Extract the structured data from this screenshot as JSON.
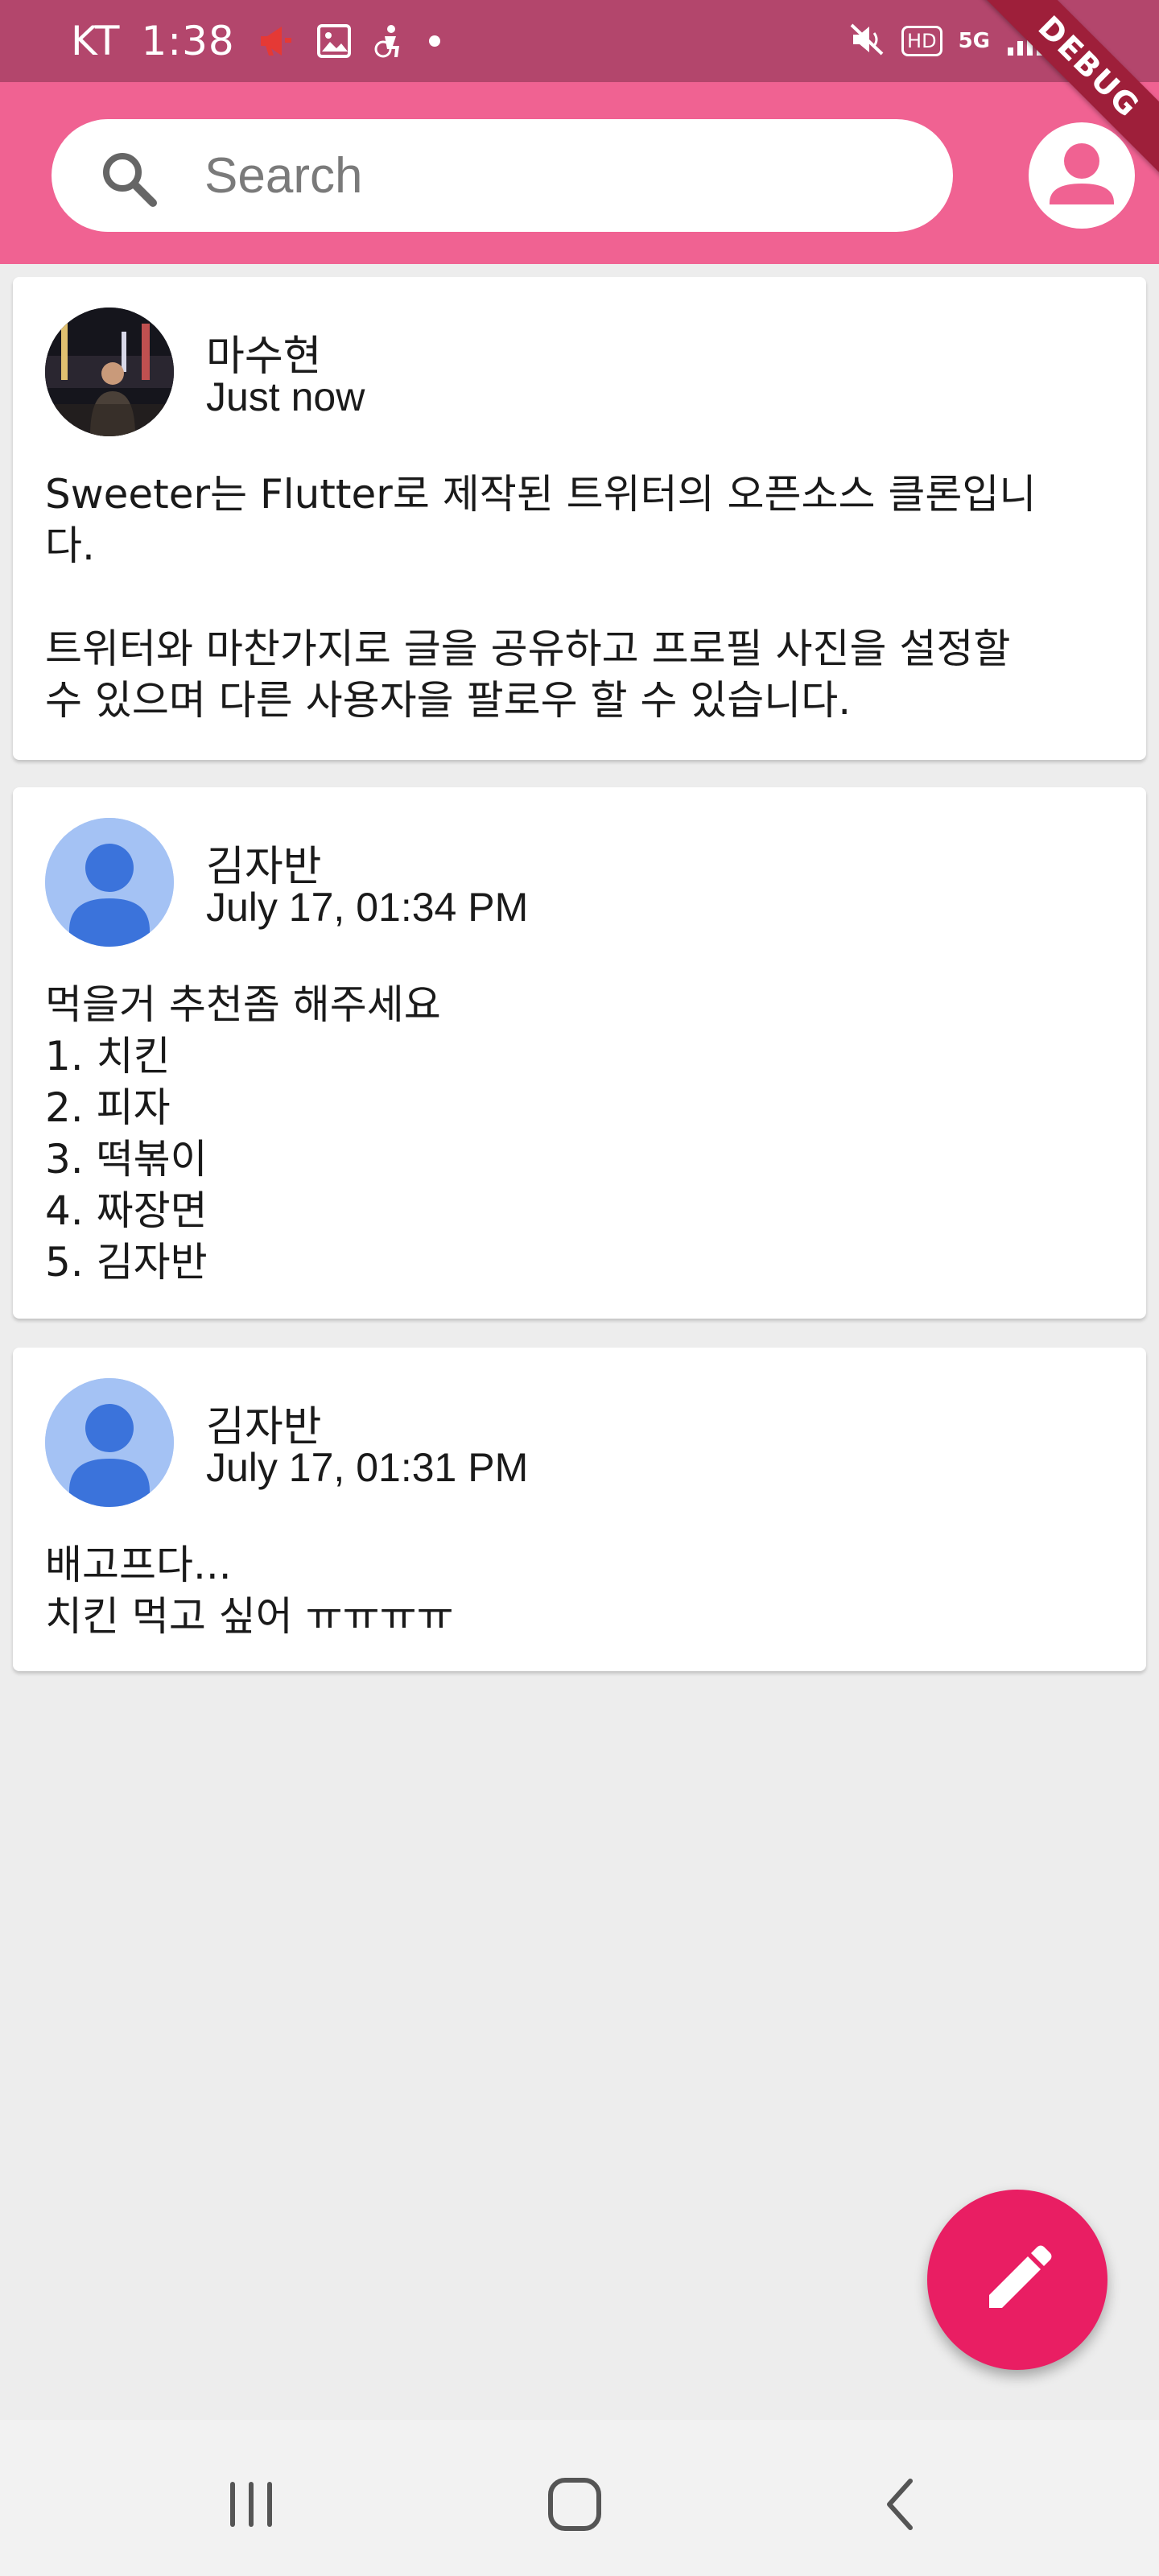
{
  "status_bar": {
    "carrier": "KT",
    "time": "1:38",
    "icons": [
      "notification-icon",
      "image-icon",
      "accessibility-icon",
      "dot-icon",
      "mute-icon",
      "hd-icon",
      "5g-icon",
      "signal-icon",
      "battery-icon"
    ],
    "hd": "HD",
    "net": "5G"
  },
  "debug_banner": "DEBUG",
  "search": {
    "placeholder": "Search",
    "value": ""
  },
  "posts": [
    {
      "author": "마수현",
      "time": "Just now",
      "avatar": "photo",
      "body": "Sweeter는 Flutter로 제작된 트위터의 오픈소스 클론입니\n다.\n\n트위터와 마찬가지로 글을 공유하고 프로필 사진을 설정할\n수 있으며 다른 사용자을 팔로우 할 수 있습니다."
    },
    {
      "author": "김자반",
      "time": "July 17, 01:34 PM",
      "avatar": "default-person",
      "body": "먹을거 추천좀 해주세요\n1. 치킨\n2. 피자\n3. 떡볶이\n4. 짜장면\n5. 김자반"
    },
    {
      "author": "김자반",
      "time": "July 17, 01:31 PM",
      "avatar": "default-person",
      "body": "배고프다...\n치킨 먹고 싶어 ㅠㅠㅠㅠ"
    }
  ],
  "colors": {
    "status_bar": "#b3466c",
    "app_bar": "#f06292",
    "fab": "#e91e63",
    "background": "#ededed",
    "default_avatar_bg": "#a4c2f4",
    "default_avatar_fg": "#3b73db"
  }
}
